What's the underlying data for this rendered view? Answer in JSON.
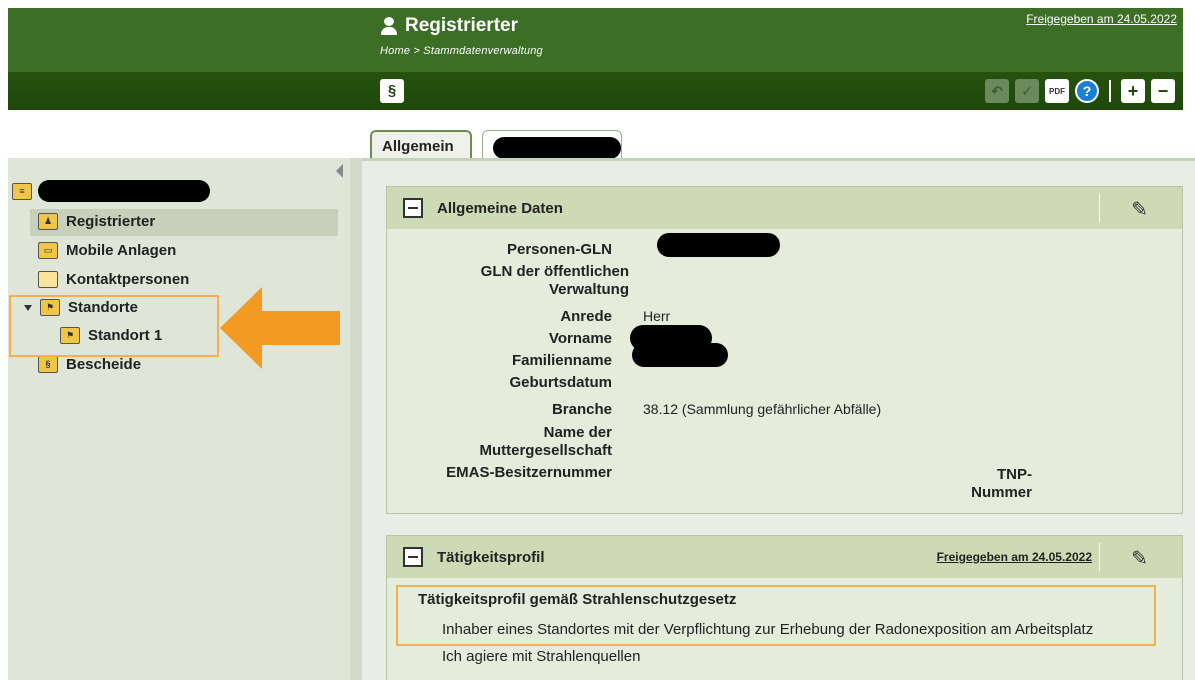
{
  "header": {
    "title": "Registrierter",
    "breadcrumb": "Home > Stammdatenverwaltung",
    "release_link": "Freigegeben am 24.05.2022",
    "para_label": "§",
    "toolbar": {
      "undo_icon": "undo-icon",
      "check_icon": "check-doc-icon",
      "pdf_label": "PDF",
      "help_label": "?",
      "expand_label": "+",
      "collapse_label": "−"
    }
  },
  "tabs": [
    {
      "label": "Allgemein",
      "active": true
    },
    {
      "label": "",
      "redacted": true
    }
  ],
  "sidebar": {
    "root_label": "",
    "items": [
      {
        "label": "Registrierter",
        "icon": "person-folder-icon",
        "selected": true
      },
      {
        "label": "Mobile Anlagen",
        "icon": "truck-folder-icon"
      },
      {
        "label": "Kontaktpersonen",
        "icon": "folder-icon"
      },
      {
        "label": "Standorte",
        "icon": "pin-folder-icon",
        "expanded": true
      },
      {
        "label": "Standort 1",
        "icon": "pin-folder-icon"
      },
      {
        "label": "Bescheide",
        "icon": "paragraph-folder-icon"
      }
    ]
  },
  "general": {
    "title": "Allgemeine Daten",
    "fields": {
      "personen_gln": {
        "label": "Personen-GLN",
        "value": ""
      },
      "gln_oeffentlich": {
        "label_line1": "GLN der öffentlichen",
        "label_line2": "Verwaltung",
        "value": ""
      },
      "anrede": {
        "label": "Anrede",
        "value": "Herr"
      },
      "vorname": {
        "label": "Vorname",
        "value": ""
      },
      "familienname": {
        "label": "Familienname",
        "value": ""
      },
      "geburtsdatum": {
        "label": "Geburtsdatum",
        "value": ""
      },
      "branche": {
        "label": "Branche",
        "value": "38.12 (Sammlung gefährlicher Abfälle)"
      },
      "muttergesellschaft": {
        "label_line1": "Name der",
        "label_line2": "Muttergesellschaft",
        "value": ""
      },
      "emas": {
        "label": "EMAS-Besitzernummer",
        "value": ""
      },
      "tnp": {
        "label_line1": "TNP-",
        "label_line2": "Nummer",
        "value": ""
      }
    }
  },
  "activity": {
    "title": "Tätigkeitsprofil",
    "release_link": "Freigegeben am 24.05.2022",
    "heading": "Tätigkeitsprofil gemäß Strahlenschutzgesetz",
    "items": [
      "Inhaber eines Standortes mit der Verpflichtung zur Erhebung der Radonexposition am Arbeitsplatz",
      "Ich agiere mit Strahlenquellen"
    ]
  },
  "colors": {
    "header_green": "#3d6e25",
    "toolbar_green": "#1f480b",
    "panel_header": "#ccdbb5",
    "highlight_orange": "#f4b04d"
  }
}
